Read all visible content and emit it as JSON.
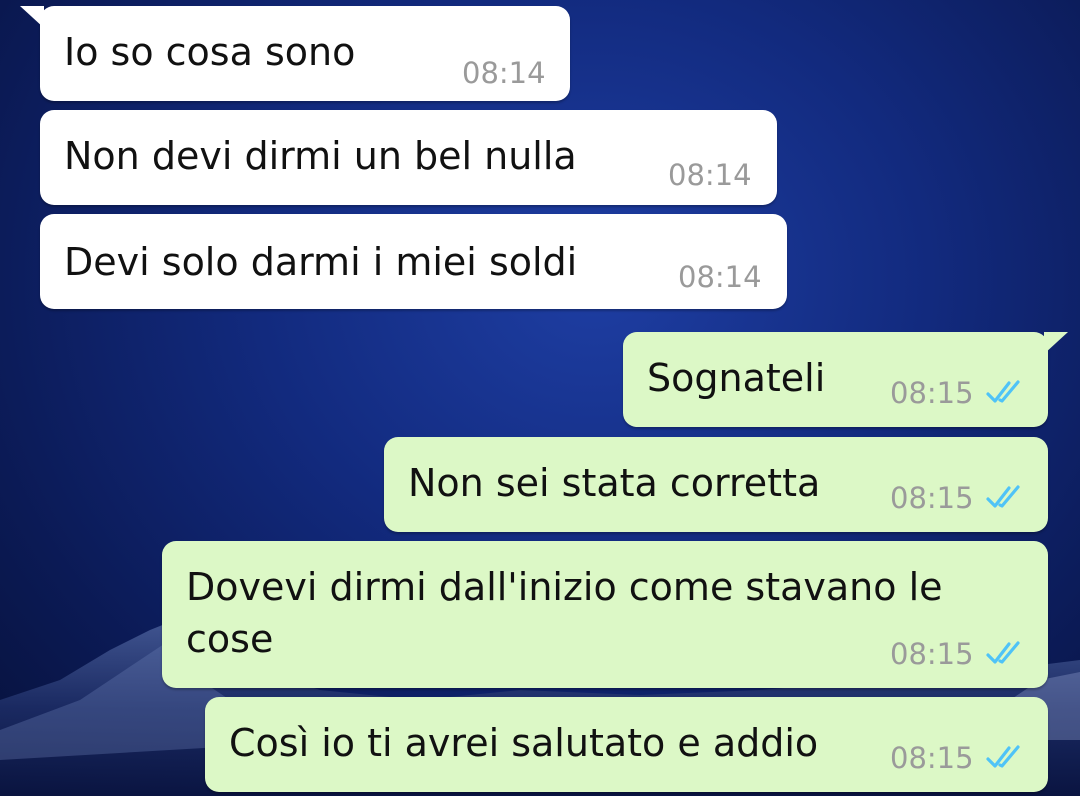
{
  "colors": {
    "incoming_bubble": "#ffffff",
    "outgoing_bubble": "#dcf8c6",
    "timestamp": "#9a9a9a",
    "read_ticks": "#4fc3f7",
    "wallpaper": "#122a7e"
  },
  "messages": [
    {
      "direction": "incoming",
      "text": "Io so cosa sono",
      "time": "08:14"
    },
    {
      "direction": "incoming",
      "text": "Non devi dirmi un bel nulla",
      "time": "08:14"
    },
    {
      "direction": "incoming",
      "text": "Devi solo darmi i miei soldi",
      "time": "08:14"
    },
    {
      "direction": "outgoing",
      "text": "Sognateli",
      "time": "08:15",
      "status_icon": "double-check-read-icon"
    },
    {
      "direction": "outgoing",
      "text": "Non sei stata corretta",
      "time": "08:15",
      "status_icon": "double-check-read-icon"
    },
    {
      "direction": "outgoing",
      "text": "Dovevi dirmi dall'inizio come stavano le cose",
      "time": "08:15",
      "status_icon": "double-check-read-icon"
    },
    {
      "direction": "outgoing",
      "text": "Così io ti avrei salutato e addio",
      "time": "08:15",
      "status_icon": "double-check-read-icon"
    }
  ]
}
